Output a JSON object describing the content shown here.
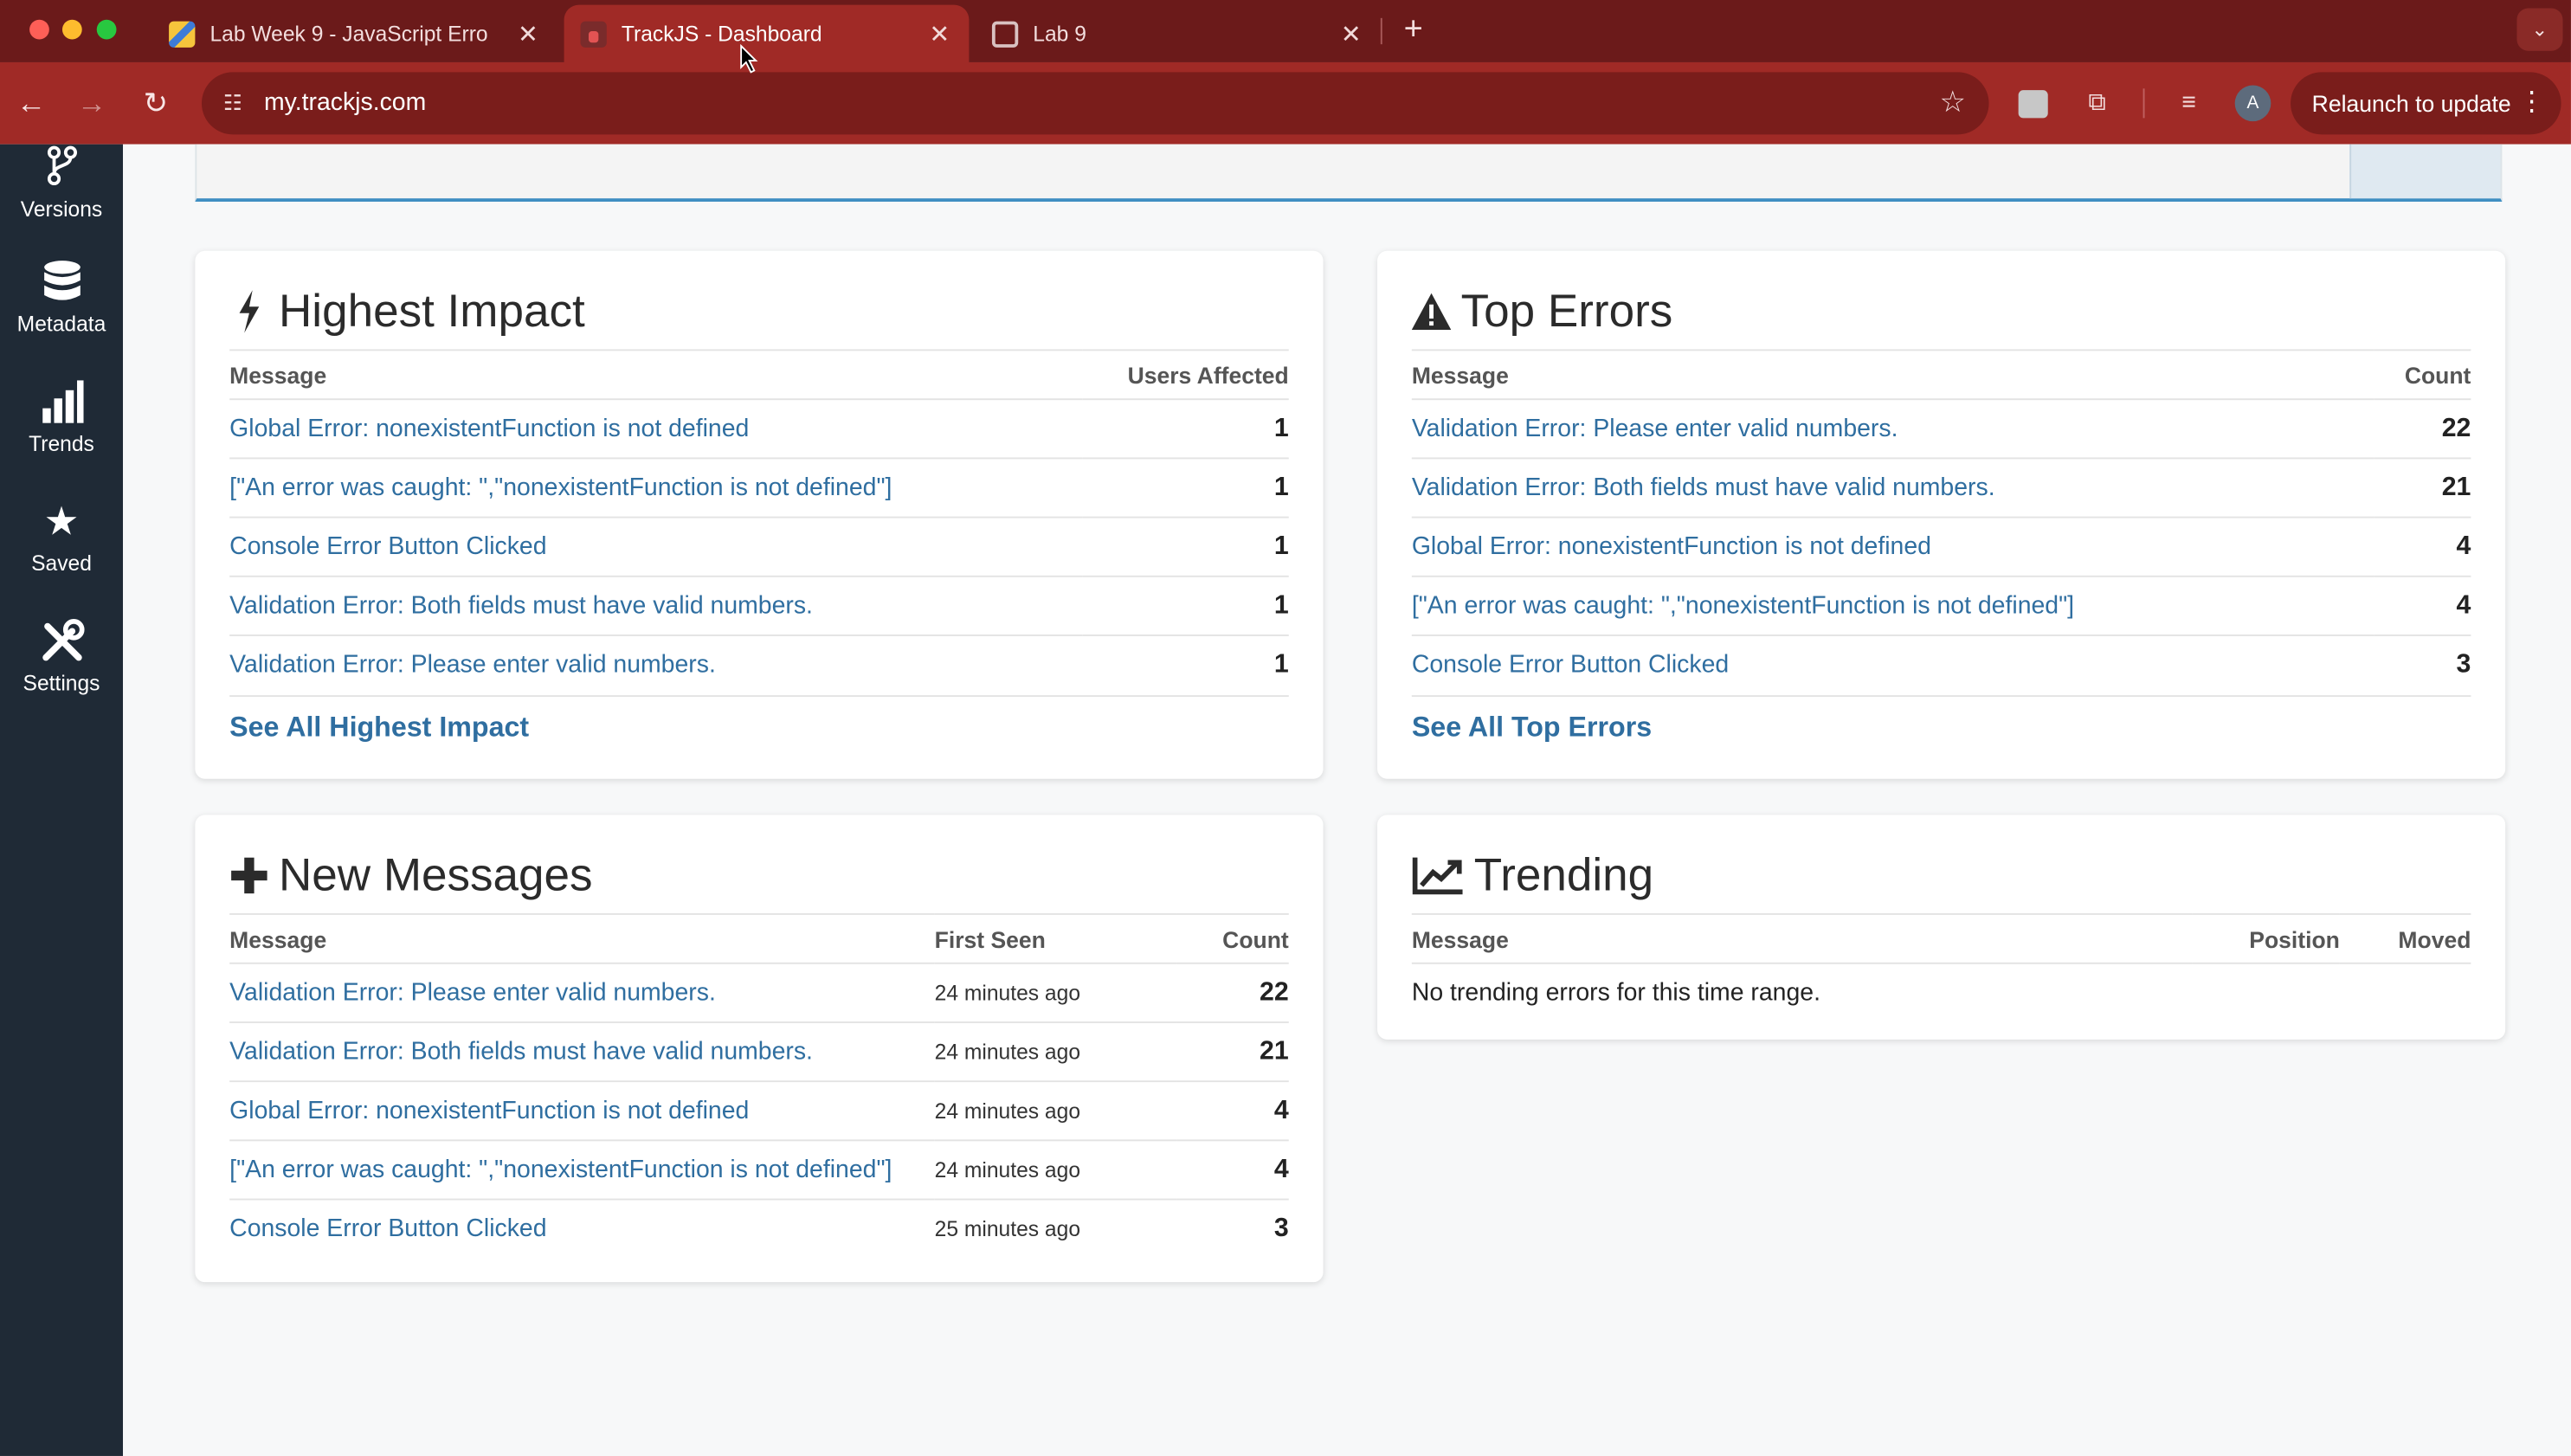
{
  "browser": {
    "tabs": [
      {
        "title": "Lab Week 9 - JavaScript Erro",
        "active": false
      },
      {
        "title": "TrackJS - Dashboard",
        "active": true
      },
      {
        "title": "Lab 9",
        "active": false
      }
    ],
    "url": "my.trackjs.com",
    "relaunch_label": "Relaunch to update",
    "profile_initial": "A"
  },
  "sidebar": {
    "items": [
      {
        "label": "Versions",
        "icon": "branch-icon"
      },
      {
        "label": "Metadata",
        "icon": "database-icon"
      },
      {
        "label": "Trends",
        "icon": "bar-chart-icon"
      },
      {
        "label": "Saved",
        "icon": "star-icon"
      },
      {
        "label": "Settings",
        "icon": "tools-icon"
      }
    ]
  },
  "highest_impact": {
    "title": "Highest Impact",
    "col_message": "Message",
    "col_users": "Users Affected",
    "rows": [
      {
        "message": "Global Error: nonexistentFunction is not defined",
        "value": "1"
      },
      {
        "message": "[\"An error was caught: \",\"nonexistentFunction is not defined\"]",
        "value": "1"
      },
      {
        "message": "Console Error Button Clicked",
        "value": "1"
      },
      {
        "message": "Validation Error: Both fields must have valid numbers.",
        "value": "1"
      },
      {
        "message": "Validation Error: Please enter valid numbers.",
        "value": "1"
      }
    ],
    "see_all": "See All Highest Impact"
  },
  "top_errors": {
    "title": "Top Errors",
    "col_message": "Message",
    "col_count": "Count",
    "rows": [
      {
        "message": "Validation Error: Please enter valid numbers.",
        "value": "22"
      },
      {
        "message": "Validation Error: Both fields must have valid numbers.",
        "value": "21"
      },
      {
        "message": "Global Error: nonexistentFunction is not defined",
        "value": "4"
      },
      {
        "message": "[\"An error was caught: \",\"nonexistentFunction is not defined\"]",
        "value": "4"
      },
      {
        "message": "Console Error Button Clicked",
        "value": "3"
      }
    ],
    "see_all": "See All Top Errors"
  },
  "new_messages": {
    "title": "New Messages",
    "col_message": "Message",
    "col_first_seen": "First Seen",
    "col_count": "Count",
    "rows": [
      {
        "message": "Validation Error: Please enter valid numbers.",
        "first_seen": "24 minutes ago",
        "value": "22"
      },
      {
        "message": "Validation Error: Both fields must have valid numbers.",
        "first_seen": "24 minutes ago",
        "value": "21"
      },
      {
        "message": "Global Error: nonexistentFunction is not defined",
        "first_seen": "24 minutes ago",
        "value": "4"
      },
      {
        "message": "[\"An error was caught: \",\"nonexistentFunction is not defined\"]",
        "first_seen": "24 minutes ago",
        "value": "4"
      },
      {
        "message": "Console Error Button Clicked",
        "first_seen": "25 minutes ago",
        "value": "3"
      }
    ]
  },
  "trending": {
    "title": "Trending",
    "col_message": "Message",
    "col_position": "Position",
    "col_moved": "Moved",
    "empty": "No trending errors for this time range."
  }
}
